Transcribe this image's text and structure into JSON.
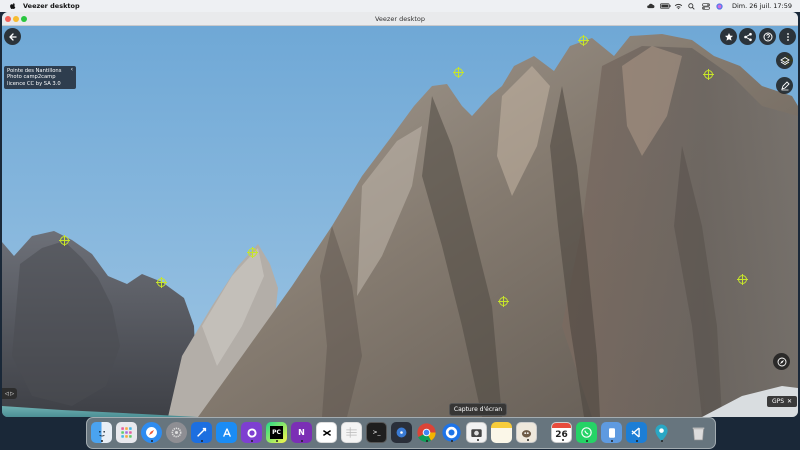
{
  "menubar": {
    "app_name": "Veezer desktop",
    "datetime": "Dim. 26 juil. 17:59"
  },
  "window": {
    "title": "Veezer desktop"
  },
  "info": {
    "line1": "Pointe des Nantillons",
    "line2": "Photo camp2camp",
    "line3": "licence CC by SA 3.0"
  },
  "left_control": {
    "label": "◁ ▷"
  },
  "gps": {
    "label": "GPS"
  },
  "tooltip": {
    "text": "Capture d'écran"
  },
  "calendar": {
    "day": "26"
  },
  "icons": {
    "back": "arrow-left-icon",
    "favorite": "star-icon",
    "share": "share-icon",
    "help": "help-icon",
    "more": "more-vertical-icon",
    "layers": "layers-icon",
    "edit": "edit-icon",
    "compass": "compass-icon"
  },
  "colors": {
    "marker": "#c7e52a",
    "sky": "#7fb3da"
  }
}
